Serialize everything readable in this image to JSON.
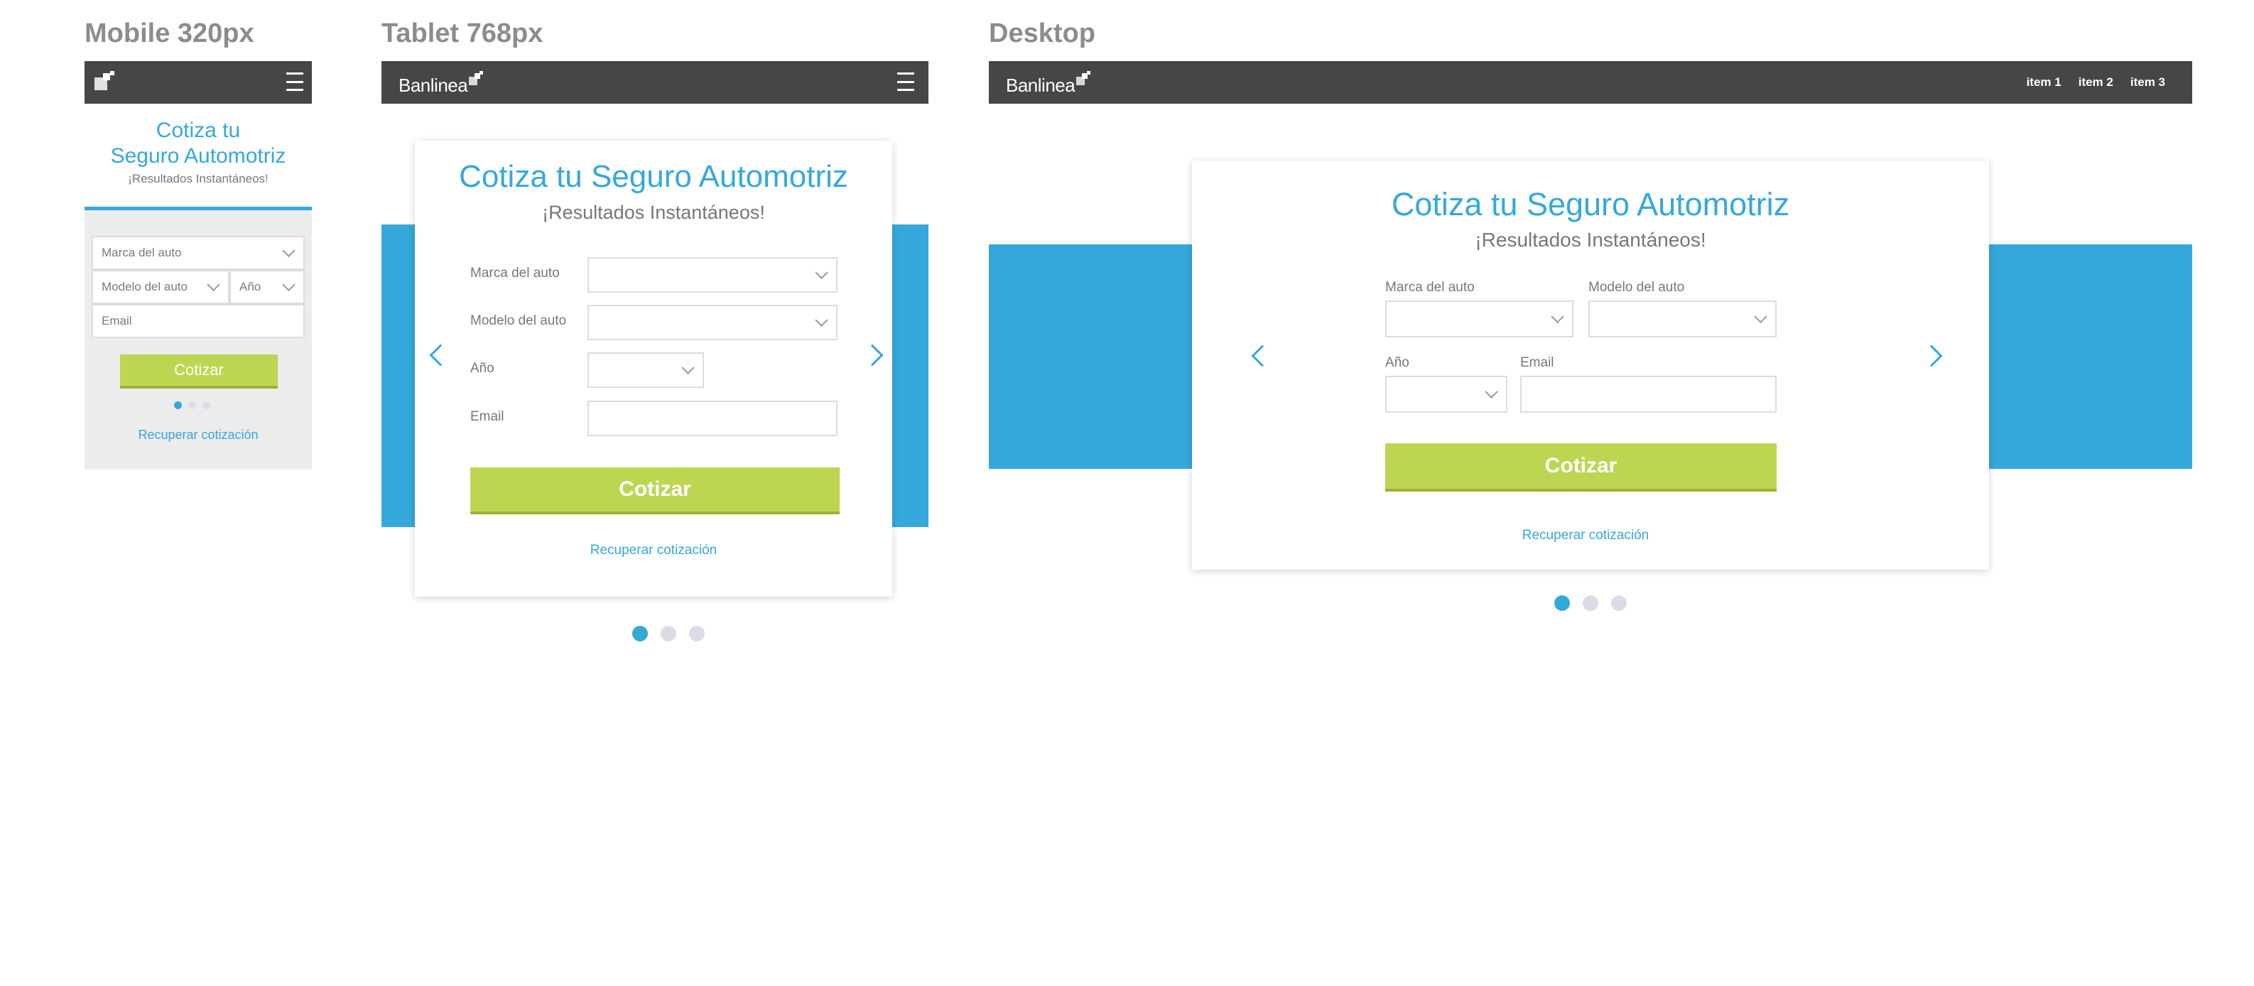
{
  "sections": {
    "mobile": "Mobile 320px",
    "tablet": "Tablet 768px",
    "desktop": "Desktop"
  },
  "brand": {
    "logo_text": "Banlinea"
  },
  "nav": {
    "items": [
      "item 1",
      "item 2",
      "item 3"
    ]
  },
  "mobile": {
    "title_line1": "Cotiza tu",
    "title_line2": "Seguro Automotriz",
    "subtitle": "¡Resultados Instantáneos!",
    "marca_placeholder": "Marca del auto",
    "modelo_placeholder": "Modelo del auto",
    "anio_placeholder": "Año",
    "email_placeholder": "Email",
    "button": "Cotizar",
    "link": "Recuperar cotización"
  },
  "tablet": {
    "title": "Cotiza tu Seguro Automotriz",
    "subtitle": "¡Resultados Instantáneos!",
    "labels": {
      "marca": "Marca del auto",
      "modelo": "Modelo del auto",
      "anio": "Año",
      "email": "Email"
    },
    "button": "Cotizar",
    "link": "Recuperar cotización"
  },
  "desktop": {
    "title": "Cotiza tu Seguro Automotriz",
    "subtitle": "¡Resultados Instantáneos!",
    "labels": {
      "marca": "Marca del auto",
      "modelo": "Modelo del auto",
      "anio": "Año",
      "email": "Email"
    },
    "button": "Cotizar",
    "link": "Recuperar cotización"
  },
  "carousel": {
    "slide_count": 3,
    "active_index": 0
  },
  "colors": {
    "accent": "#35a8db",
    "button": "#bdd652",
    "navbar": "#464646",
    "dot_inactive": "#dcdce8"
  }
}
